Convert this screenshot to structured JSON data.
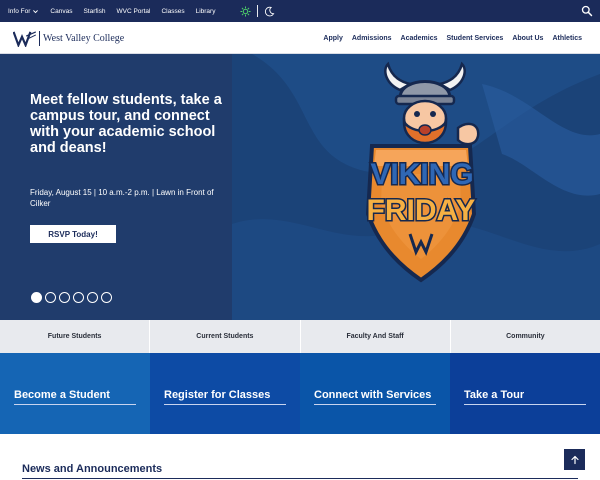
{
  "utility": {
    "links": [
      "Info For",
      "Canvas",
      "Starfish",
      "WVC Portal",
      "Classes",
      "Library"
    ]
  },
  "header": {
    "logo_text": "West Valley College",
    "nav": [
      "Apply",
      "Admissions",
      "Academics",
      "Student Services",
      "About Us",
      "Athletics"
    ]
  },
  "hero": {
    "title": "Meet fellow students, take a campus tour, and connect with your academic school and deans!",
    "date": "Friday, August 15 | 10 a.m.-2 p.m. | Lawn in Front of Cilker",
    "button": "RSVP Today!",
    "slide_count": 6,
    "active_slide": 1,
    "badge_line1": "VIKING",
    "badge_line2": "FRIDAY"
  },
  "audience_tabs": [
    "Future Students",
    "Current Students",
    "Faculty And Staff",
    "Community"
  ],
  "cta_tiles": [
    {
      "label": "Become a Student",
      "color": "#1565b4"
    },
    {
      "label": "Register for Classes",
      "color": "#0d4ba5"
    },
    {
      "label": "Connect with Services",
      "color": "#0a55a8"
    },
    {
      "label": "Take a Tour",
      "color": "#0c3f99"
    }
  ],
  "news": {
    "title": "News and Announcements"
  },
  "colors": {
    "navy": "#1b2b5a",
    "hero_left": "#203c6c",
    "hero_right": "#1b4378",
    "badge_orange": "#e8892e",
    "badge_blue": "#2f67b5"
  },
  "icons": {
    "chevron": "chevron-down-icon",
    "sun": "sun-icon",
    "moon": "moon-icon",
    "search": "search-icon",
    "back_to_top": "arrow-up-icon"
  }
}
